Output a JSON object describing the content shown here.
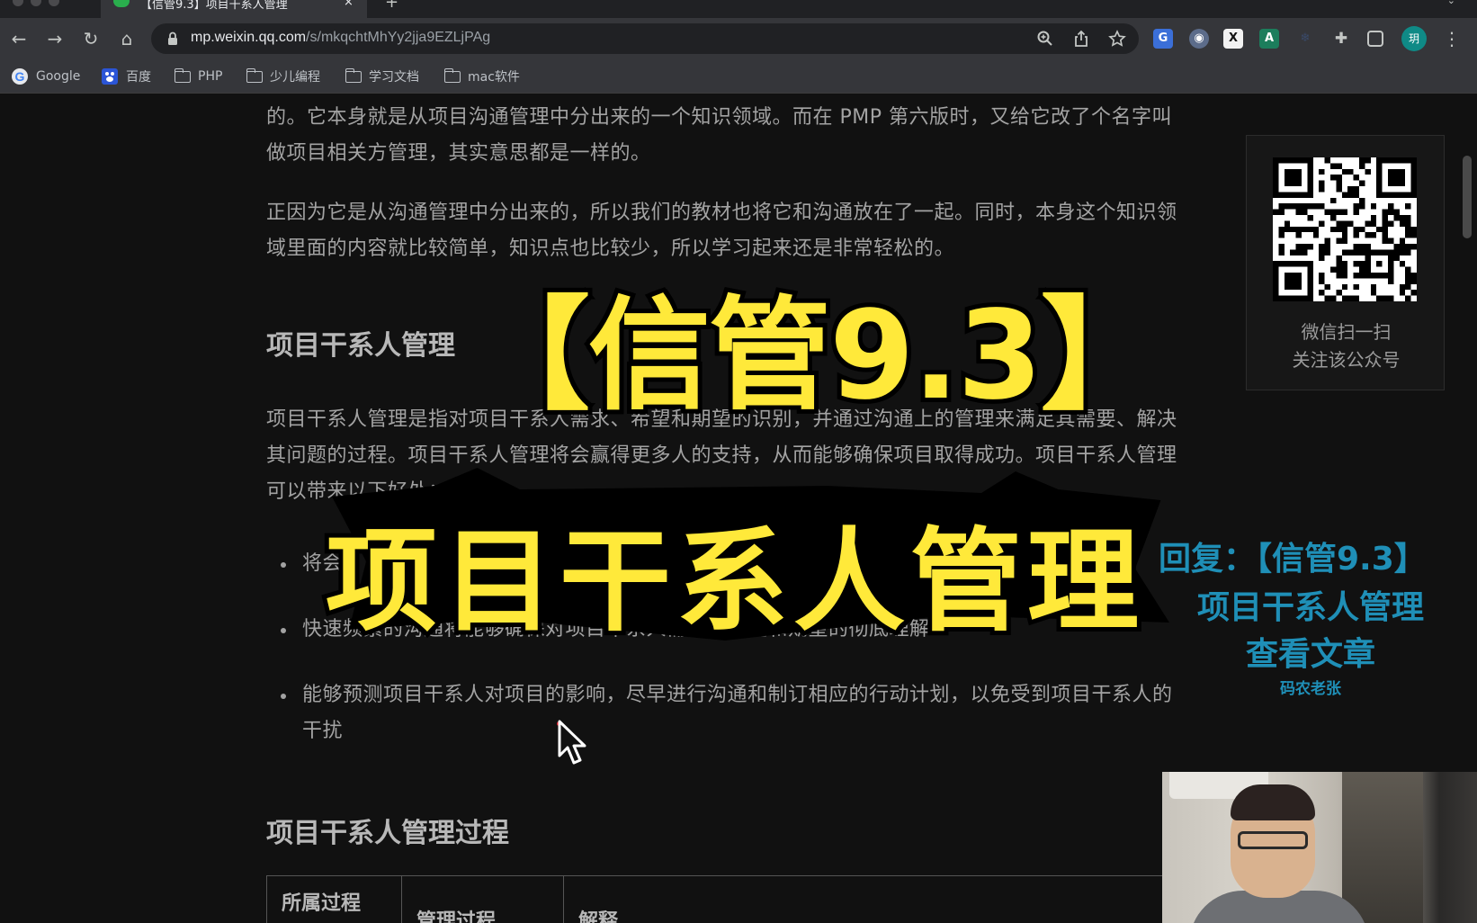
{
  "browser": {
    "tab": {
      "title": "【信管9.3】项目干系人管理",
      "close": "×"
    },
    "new_tab": "+",
    "nav": {
      "back": "←",
      "forward": "→",
      "reload": "↻",
      "home": "⌂"
    },
    "url": {
      "host": "mp.weixin.qq.com",
      "path": "/s/mkqchtMhYy2jja9EZLjPAg"
    },
    "profile_initial": "玥",
    "extensions": [
      {
        "name": "google-translate-icon",
        "label": "G"
      },
      {
        "name": "circle-extension-icon",
        "label": "◉"
      },
      {
        "name": "x-extension-icon",
        "label": "X"
      },
      {
        "name": "a-extension-icon",
        "label": "A"
      }
    ],
    "bookmarks": [
      {
        "label": "Google",
        "icon": "google-icon"
      },
      {
        "label": "百度",
        "icon": "baidu-icon"
      },
      {
        "label": "PHP",
        "icon": "folder-icon"
      },
      {
        "label": "少儿编程",
        "icon": "folder-icon"
      },
      {
        "label": "学习文档",
        "icon": "folder-icon"
      },
      {
        "label": "mac软件",
        "icon": "folder-icon"
      }
    ]
  },
  "article": {
    "para_1": "的。它本身就是从项目沟通管理中分出来的一个知识领域。而在 PMP 第六版时，又给它改了个名字叫做项目相关方管理，其实意思都是一样的。",
    "para_2": "正因为它是从沟通管理中分出来的，所以我们的教材也将它和沟通放在了一起。同时，本身这个知识领域里面的内容就比较简单，知识点也比较少，所以学习起来还是非常轻松的。",
    "heading_1": "项目干系人管理",
    "para_3": "项目干系人管理是指对项目干系人需求、希望和期望的识别，并通过沟通上的管理来满足其需要、解决其问题的过程。项目干系人管理将会赢得更多人的支持，从而能够确保项目取得成功。项目干系人管理可以带来以下好处：",
    "bullets": [
      "将会",
      "快速频繁的沟通将能够确保对项目干系人需要、希望和期望的彻底理解",
      "能够预测项目干系人对项目的影响，尽早进行沟通和制订相应的行动计划，以免受到项目干系人的干扰"
    ],
    "heading_2": "项目干系人管理过程",
    "table_headers": [
      "所属过程",
      "管理过程",
      "解释"
    ]
  },
  "qr_card": {
    "caption_1": "微信扫一扫",
    "caption_2": "关注该公众号"
  },
  "overlay": {
    "title": "【信管9.3】",
    "subtitle": "项目干系人管理",
    "cta_reply": "回复：【信管9.3】",
    "cta_name": "项目干系人管理",
    "cta_view": "查看文章",
    "cta_author": "码农老张"
  },
  "colors": {
    "overlay_yellow": "#ffe93a",
    "cta_blue": "#1f8fb7",
    "page_bg": "#111111"
  }
}
